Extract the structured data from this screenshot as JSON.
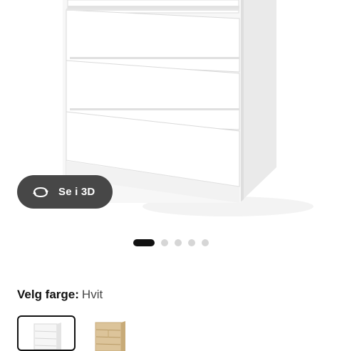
{
  "product_gallery": {
    "view_3d_label": "Se i 3D",
    "view_3d_icon": "rotate-3d-icon",
    "dots_total": 5,
    "active_dot": 1
  },
  "color_picker": {
    "title": "Velg farge:",
    "selected_value": "Hvit",
    "swatches": [
      {
        "name": "white",
        "color": "#f3f3f3",
        "selected": true
      },
      {
        "name": "birch-veneer",
        "color": "#dcc49a",
        "selected": false
      }
    ]
  }
}
